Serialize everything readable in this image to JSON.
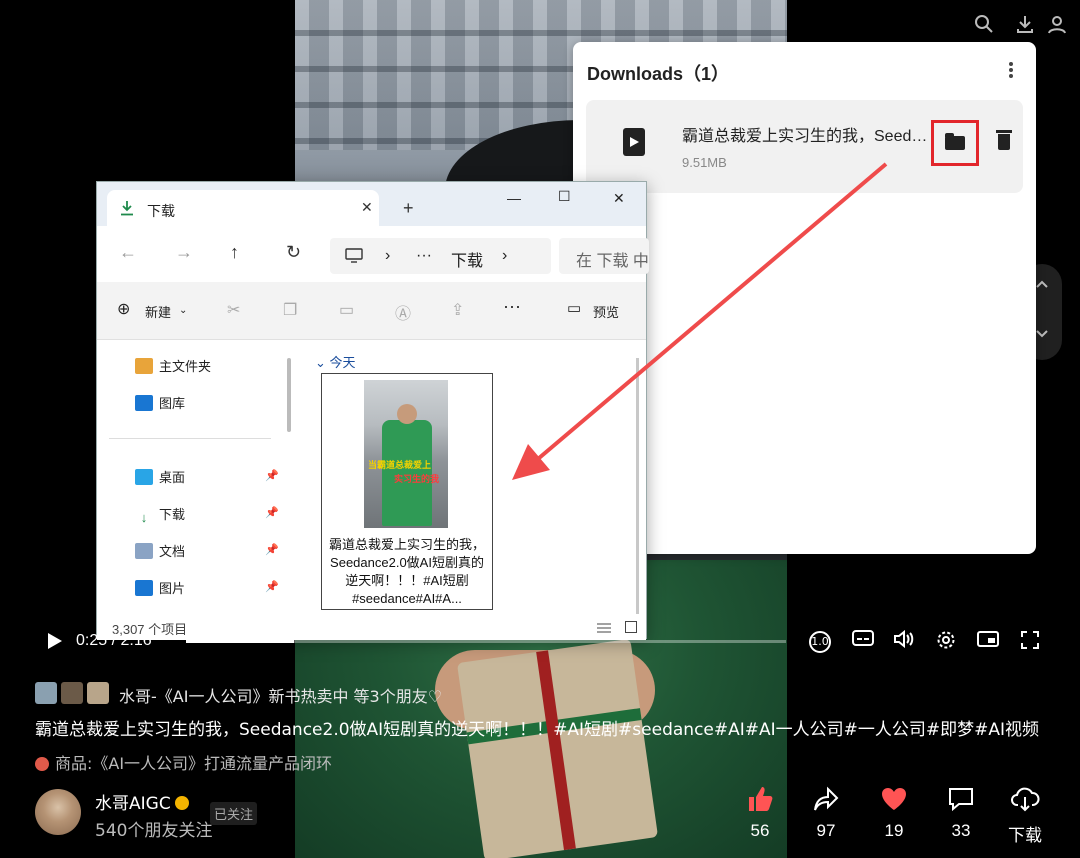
{
  "downloads": {
    "title": "Downloads（1）",
    "item": {
      "name": "霸道总裁爱上实习生的我，Seedance2.0做AI短剧真的逆天啊！！！#AI短剧#seedance#AI#A…",
      "size": "9.51MB"
    }
  },
  "explorer": {
    "tab_label": "下载",
    "address_segments": [
      "›",
      "···",
      "下载",
      "›"
    ],
    "search_placeholder": "在 下载 中",
    "commands": {
      "new": "新建",
      "preview": "预览"
    },
    "sidebar": [
      {
        "label": "主文件夹"
      },
      {
        "label": "图库"
      },
      {
        "label": "桌面"
      },
      {
        "label": "下载"
      },
      {
        "label": "文档"
      },
      {
        "label": "图片"
      }
    ],
    "group_label": "今天",
    "thumbnail": {
      "title_overlay": "当霸道总裁爱上",
      "title_overlay2": "实习生的我",
      "caption": "霸道总裁爱上实习生的我，Seedance2.0做AI短剧真的逆天啊！！！#AI短剧#seedance#AI#A..."
    },
    "status": "3,307 个项目"
  },
  "player": {
    "time": "0:25 / 2:16",
    "progress_fraction": 0.18,
    "speed_badge": "1.0"
  },
  "info": {
    "friends_text": "水哥-《AI一人公司》新书热卖中 等3个朋友♡",
    "description": "霸道总裁爱上实习生的我，Seedance2.0做AI短剧真的逆天啊！！！#AI短剧#seedance#AI#AI一人公司#一人公司#即梦#AI视频",
    "product": "商品:《AI一人公司》打通流量产品闭环",
    "author": "水哥AIGC",
    "followers": "540个朋友关注",
    "followed": "已关注"
  },
  "actions": [
    {
      "icon": "thumb-up-icon",
      "count": "56"
    },
    {
      "icon": "share-icon",
      "count": "97"
    },
    {
      "icon": "heart-icon",
      "count": "19"
    },
    {
      "icon": "comment-icon",
      "count": "33"
    },
    {
      "icon": "download-icon",
      "count": "下载"
    }
  ],
  "colors": {
    "highlight": "#e2262b",
    "arrow": "#ef4b4b",
    "like": "#ff5454"
  }
}
